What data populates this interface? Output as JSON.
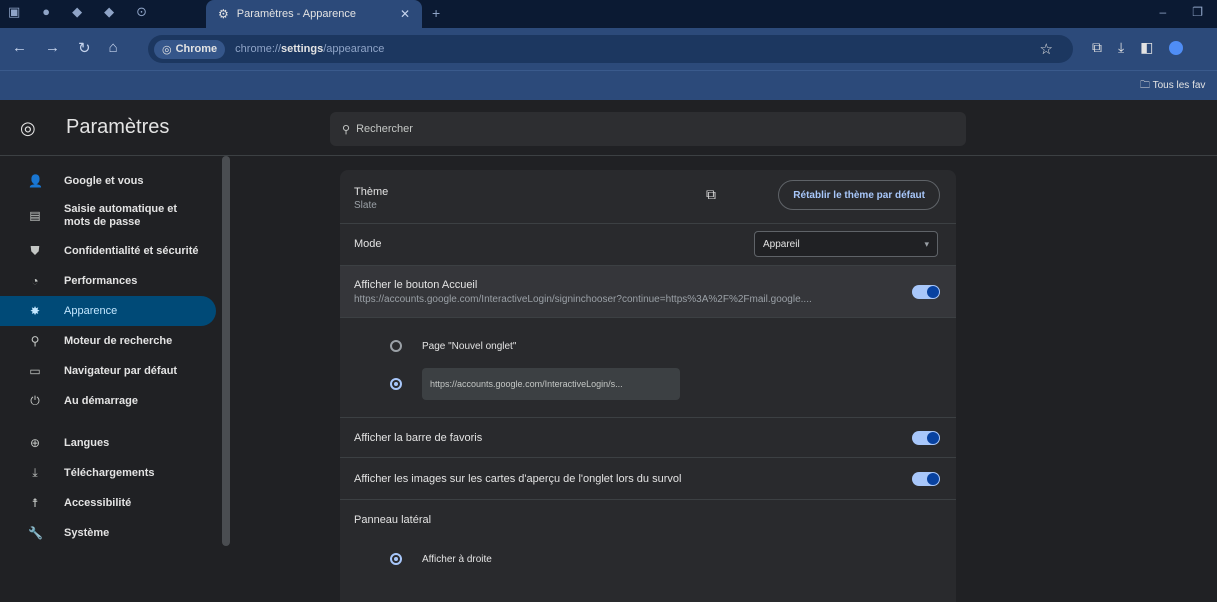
{
  "browser": {
    "tab_title": "Paramètres - Apparence",
    "omnibox_chip": "Chrome",
    "url_prefix": "chrome://",
    "url_bold": "settings",
    "url_suffix": "/appearance",
    "bookmark_folder": "Tous les fav"
  },
  "settings": {
    "title": "Paramètres",
    "search_placeholder": "Rechercher"
  },
  "sidebar": {
    "items": [
      {
        "label": "Google et vous",
        "icon": "person-icon"
      },
      {
        "label": "Saisie automatique et mots de passe",
        "icon": "autofill-icon"
      },
      {
        "label": "Confidentialité et sécurité",
        "icon": "shield-icon"
      },
      {
        "label": "Performances",
        "icon": "speedometer-icon"
      },
      {
        "label": "Apparence",
        "icon": "palette-icon",
        "active": true
      },
      {
        "label": "Moteur de recherche",
        "icon": "search-icon"
      },
      {
        "label": "Navigateur par défaut",
        "icon": "browser-icon"
      },
      {
        "label": "Au démarrage",
        "icon": "power-icon"
      },
      {
        "label": "Langues",
        "icon": "globe-icon"
      },
      {
        "label": "Téléchargements",
        "icon": "download-icon"
      },
      {
        "label": "Accessibilité",
        "icon": "accessibility-icon"
      },
      {
        "label": "Système",
        "icon": "wrench-icon"
      }
    ]
  },
  "appearance": {
    "theme": {
      "label": "Thème",
      "value": "Slate",
      "reset_button": "Rétablir le thème par défaut"
    },
    "mode": {
      "label": "Mode",
      "selected": "Appareil"
    },
    "home_button": {
      "label": "Afficher le bouton Accueil",
      "url": "https://accounts.google.com/InteractiveLogin/signinchooser?continue=https%3A%2F%2Fmail.google....",
      "enabled": true,
      "option_new_tab": "Page \"Nouvel onglet\"",
      "custom_url": "https://accounts.google.com/InteractiveLogin/s..."
    },
    "bookmarks_bar": {
      "label": "Afficher la barre de favoris",
      "enabled": true
    },
    "tab_hover_images": {
      "label": "Afficher les images sur les cartes d'aperçu de l'onglet lors du survol",
      "enabled": true
    },
    "side_panel": {
      "label": "Panneau latéral",
      "option_right": "Afficher à droite"
    }
  },
  "colors": {
    "accent": "#a8c7fa",
    "active_nav": "#004a77",
    "toolbar": "#2c4a7a"
  }
}
